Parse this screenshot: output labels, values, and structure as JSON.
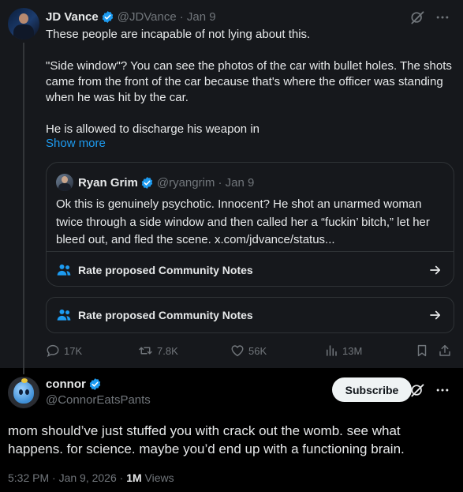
{
  "post": {
    "author_name": "JD Vance",
    "author_handle": "@JDVance",
    "date": "· Jan 9",
    "paragraphs": [
      "These people are incapable of not lying about this.",
      "\"Side window\"? You can see the photos of the car with bullet holes. The shots came from the front of the car because that's where the officer was standing when he was hit by the car.",
      "He is allowed to discharge his weapon in"
    ],
    "show_more": "Show more",
    "quote": {
      "author_name": "Ryan Grim",
      "author_handle": "@ryangrim",
      "date": "· Jan 9",
      "text": "Ok this is genuinely psychotic. Innocent? He shot an unarmed woman twice through a side window and then called her a “fuckin’ bitch,” let her bleed out, and fled the scene. x.com/jdvance/status...",
      "community_notes_label": "Rate proposed Community Notes"
    },
    "community_notes_label": "Rate proposed Community Notes",
    "stats": {
      "replies": "17K",
      "reposts": "7.8K",
      "likes": "56K",
      "views": "13M"
    }
  },
  "reply": {
    "author_name": "connor",
    "author_handle": "@ConnorEatsPants",
    "subscribe_label": "Subscribe",
    "text": "mom should’ve just stuffed you with crack out the womb. see what happens. for science. maybe you’d end up with a functioning brain.",
    "timestamp": "5:32 PM · Jan 9, 2026 ·",
    "views_count": "1M",
    "views_label": "Views"
  },
  "colors": {
    "accent": "#1d9bf0",
    "muted": "#71767b",
    "text": "#e7e9ea",
    "background": "#000000",
    "highlight_bg": "#16181c"
  },
  "icons": [
    "verified-badge-icon",
    "grok-icon",
    "more-icon",
    "community-notes-icon",
    "arrow-right-icon",
    "reply-icon",
    "repost-icon",
    "like-icon",
    "views-icon",
    "bookmark-icon",
    "share-icon"
  ]
}
